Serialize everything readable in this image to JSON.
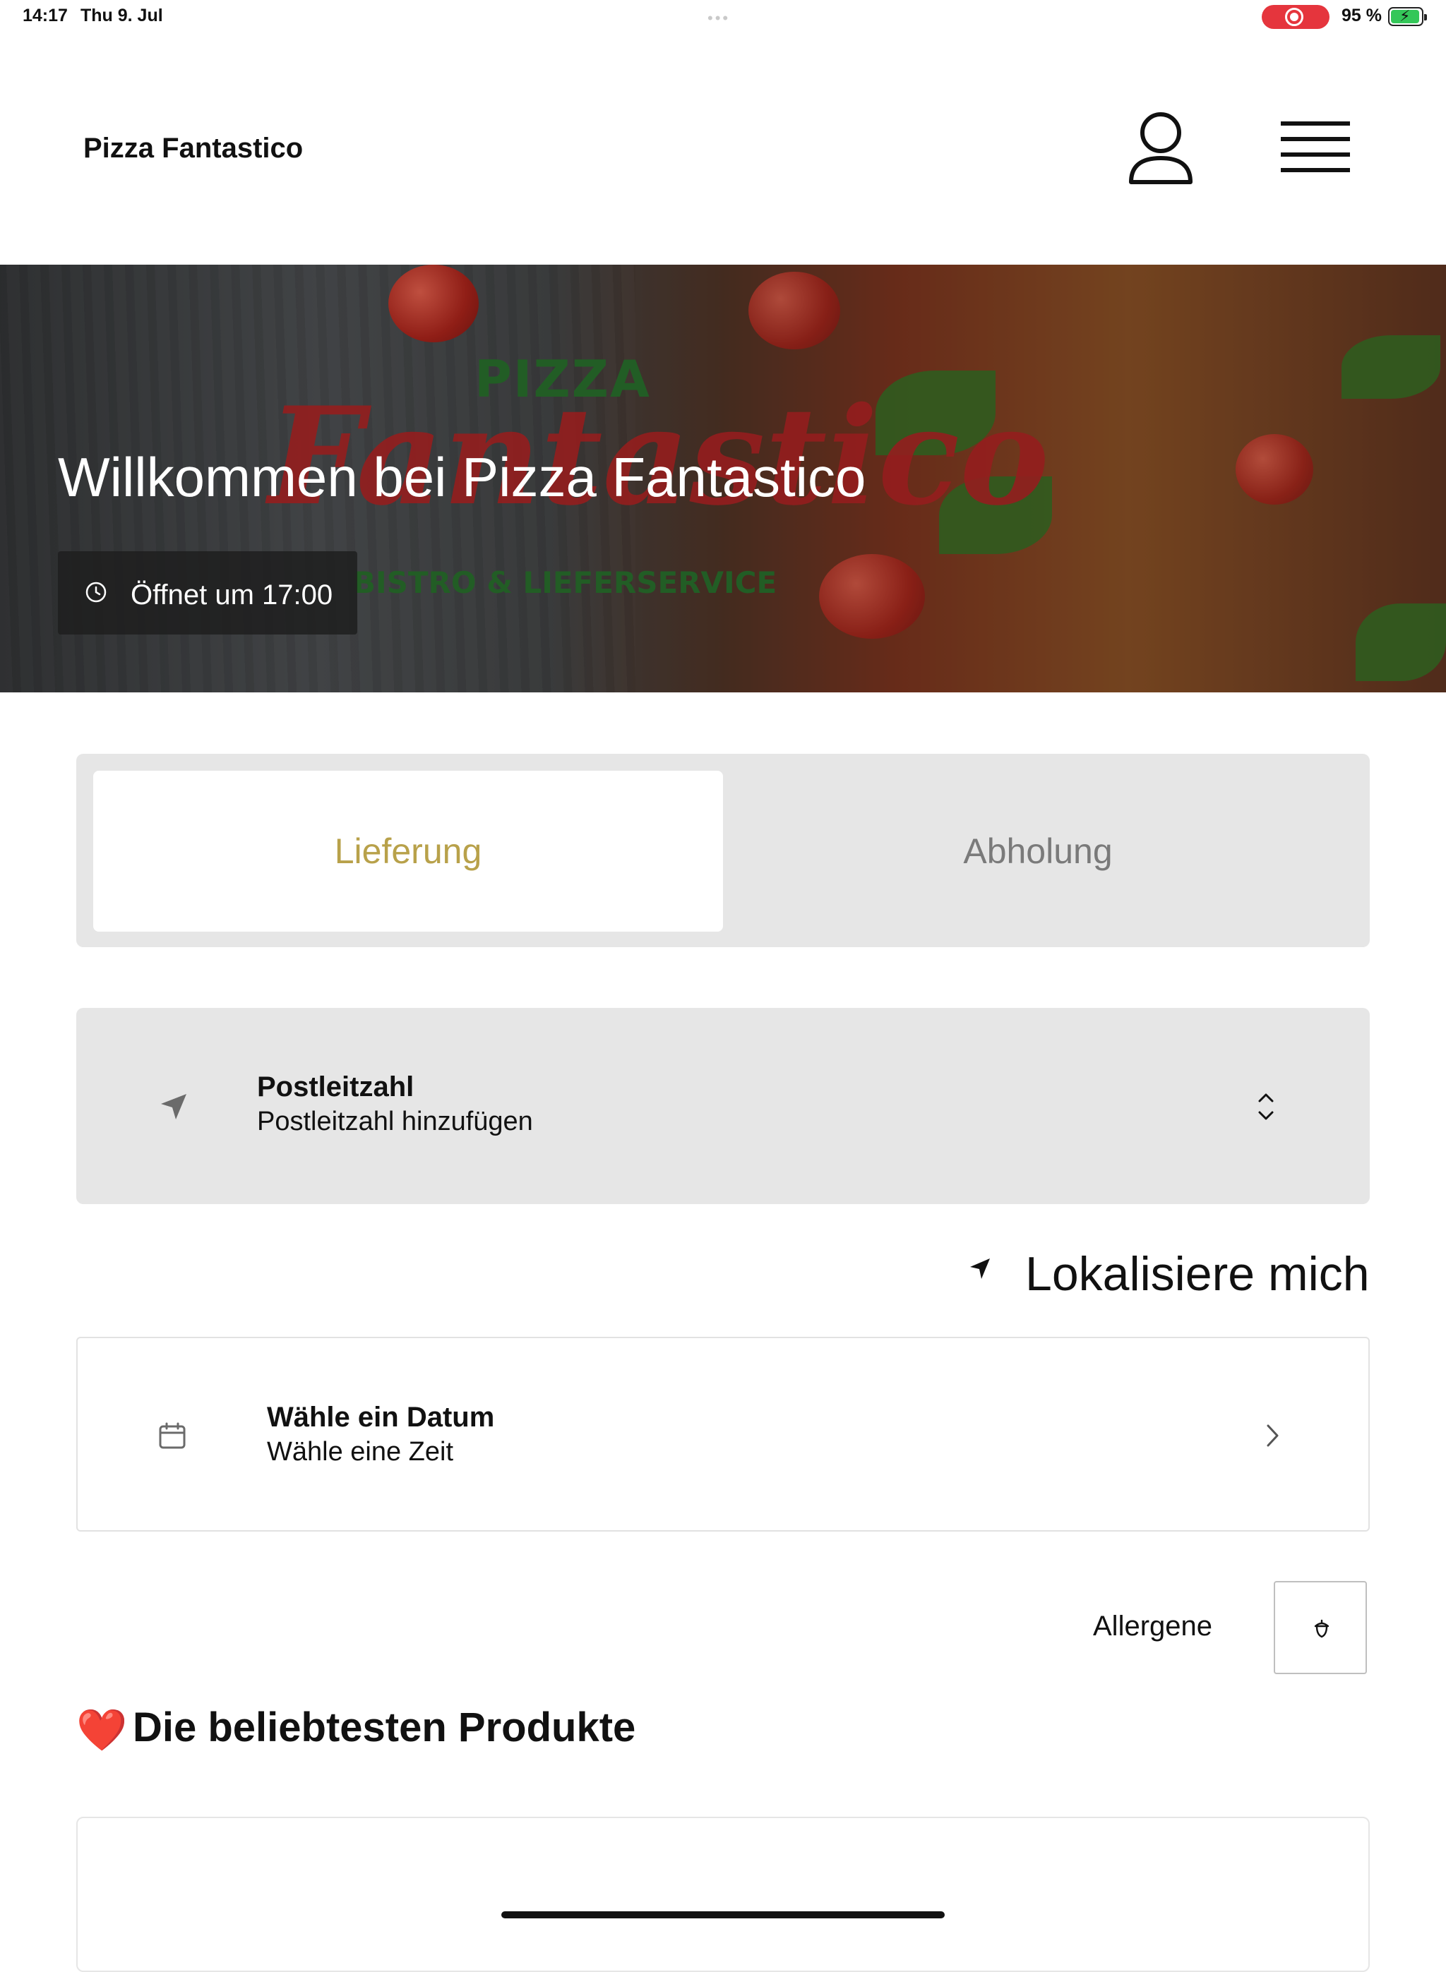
{
  "status_bar": {
    "time": "14:17",
    "date": "Thu 9. Jul",
    "battery_percent": "95 %",
    "battery_level": 0.95,
    "record_color": "#e5353d"
  },
  "header": {
    "brand": "Pizza Fantastico",
    "user_icon": "user-icon",
    "menu_icon": "hamburger-menu-icon"
  },
  "hero": {
    "title": "Willkommen bei Pizza Fantastico",
    "hours": "Öffnet um 17:00",
    "logo_top": "PIZZA",
    "logo_script": "Fantastico",
    "logo_sub": "BISTRO & LIEFERSERVICE"
  },
  "order_mode": {
    "options": [
      "Lieferung",
      "Abholung"
    ],
    "selected": "Lieferung",
    "accent_color": "#b8a14a"
  },
  "postal": {
    "title": "Postleitzahl",
    "subtitle": "Postleitzahl hinzufügen",
    "icon": "navigation-arrow-icon"
  },
  "locate": {
    "label": "Lokalisiere mich",
    "icon": "location-arrow-icon"
  },
  "schedule": {
    "title": "Wähle ein Datum",
    "subtitle": "Wähle eine Zeit",
    "icon": "calendar-icon"
  },
  "allergens": {
    "label": "Allergene",
    "icon": "acorn-icon"
  },
  "popular": {
    "emoji": "❤️",
    "title": "Die beliebtesten Produkte"
  }
}
